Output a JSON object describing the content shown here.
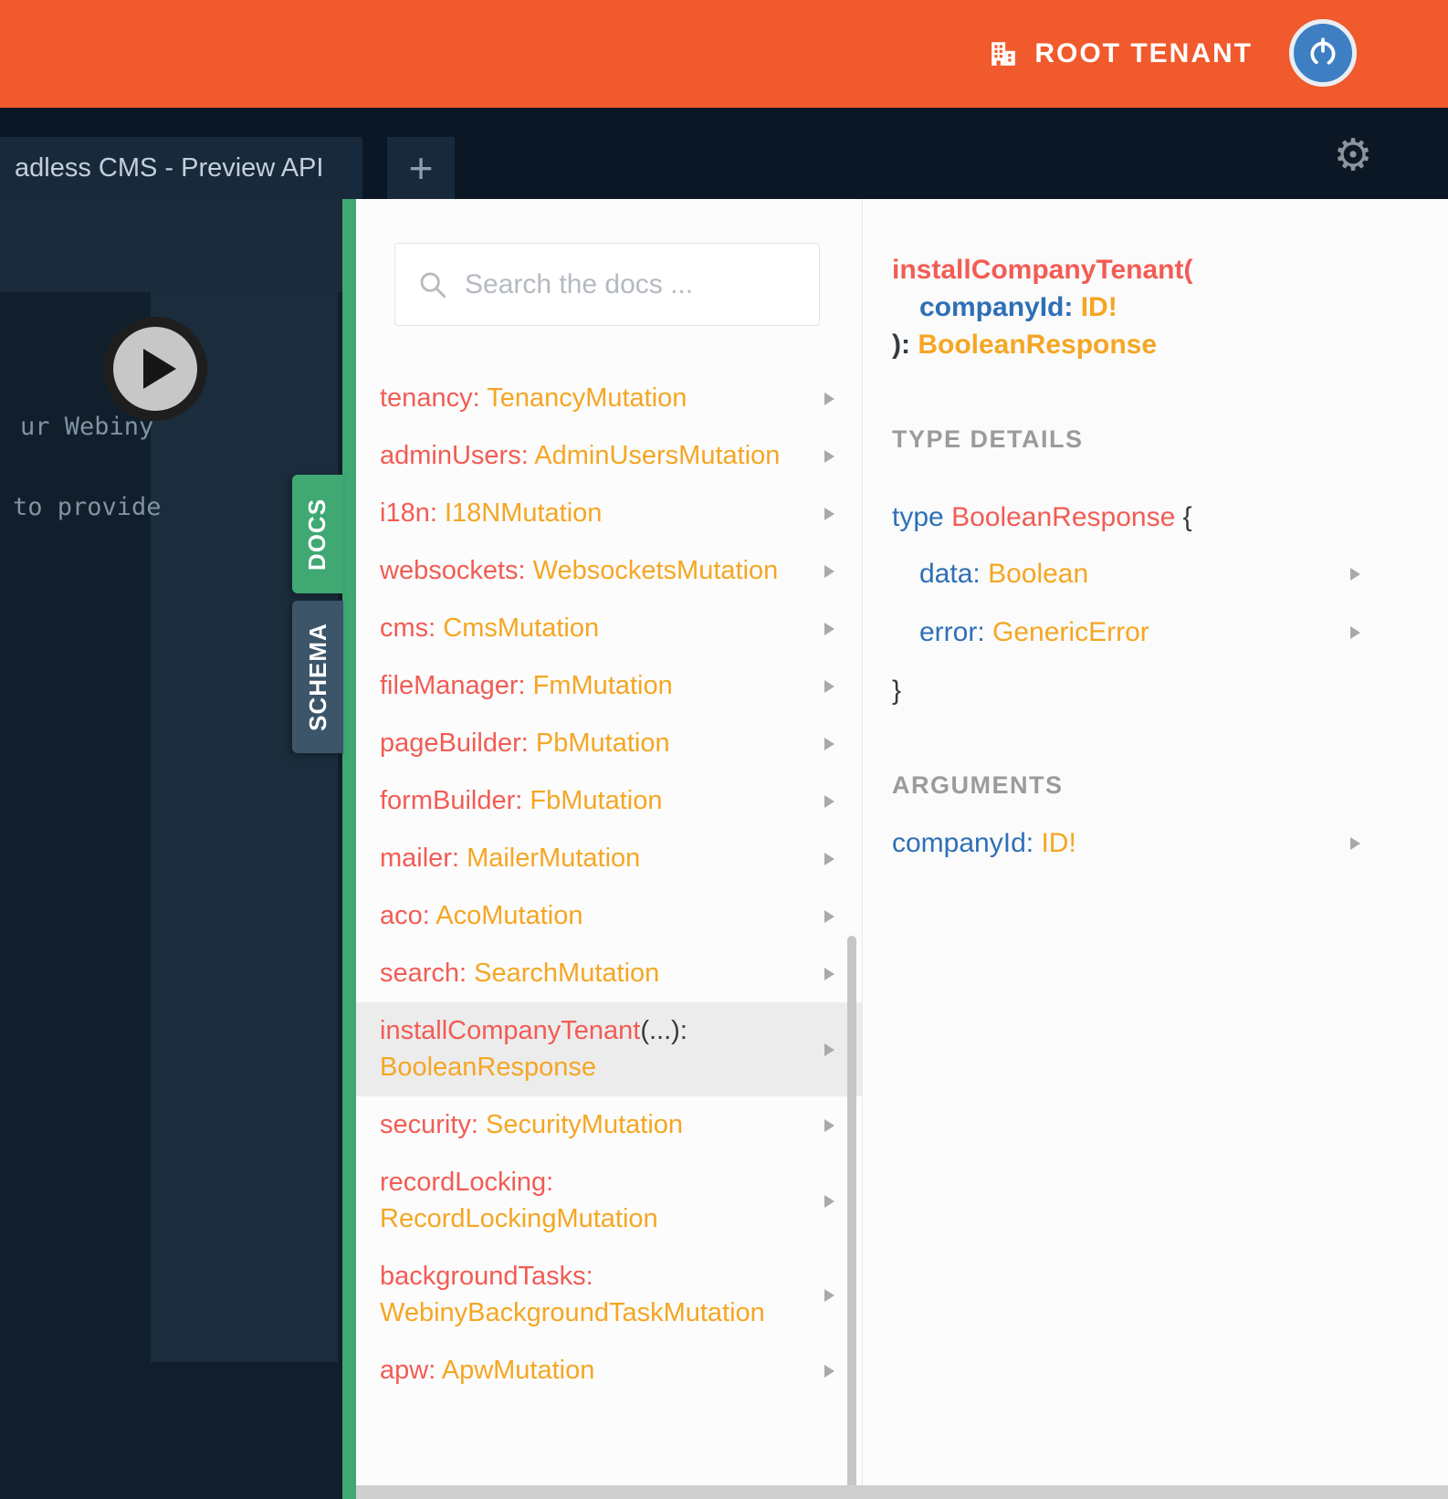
{
  "colors": {
    "accent_orange": "#f05a2c",
    "docs_green": "#3fa873",
    "schema_slate": "#3d5569",
    "field_red": "#f25c54",
    "type_orange": "#f5a623",
    "keyword_blue": "#2e6fb7"
  },
  "icons": {
    "gear_glyph": "⚙",
    "add_tab_glyph": "+"
  },
  "header": {
    "tenant_label": "ROOT TENANT"
  },
  "tabbar": {
    "tab_title": "adless CMS - Preview API"
  },
  "editor": {
    "line1": "ur Webiny",
    "line2": "to provide"
  },
  "side_tabs": {
    "docs": "DOCS",
    "schema": "SCHEMA"
  },
  "docs": {
    "search_placeholder": "Search the docs ...",
    "items": [
      {
        "name": "tenancy:",
        "type": "TenancyMutation"
      },
      {
        "name": "adminUsers:",
        "type": "AdminUsersMutation"
      },
      {
        "name": "i18n:",
        "type": "I18NMutation"
      },
      {
        "name": "websockets:",
        "type": "WebsocketsMutation"
      },
      {
        "name": "cms:",
        "type": "CmsMutation"
      },
      {
        "name": "fileManager:",
        "type": "FmMutation"
      },
      {
        "name": "pageBuilder:",
        "type": "PbMutation"
      },
      {
        "name": "formBuilder:",
        "type": "FbMutation"
      },
      {
        "name": "mailer:",
        "type": "MailerMutation"
      },
      {
        "name": "aco:",
        "type": "AcoMutation"
      },
      {
        "name": "search:",
        "type": "SearchMutation"
      },
      {
        "name": "installCompanyTenant",
        "paren": "(...):",
        "type": "BooleanResponse"
      },
      {
        "name": "security:",
        "type": "SecurityMutation"
      },
      {
        "name": "recordLocking:",
        "type": "RecordLockingMutation"
      },
      {
        "name": "backgroundTasks:",
        "type": "WebinyBackgroundTaskMutation"
      },
      {
        "name": "apw:",
        "type": "ApwMutation"
      }
    ]
  },
  "detail": {
    "signature": {
      "name": "installCompanyTenant(",
      "arg_name": "companyId:",
      "arg_type": "ID!",
      "close": "):",
      "return_type": "BooleanResponse"
    },
    "type_details_heading": "TYPE DETAILS",
    "type_keyword": "type",
    "type_name": "BooleanResponse",
    "open_brace": "{",
    "fields": [
      {
        "name": "data:",
        "type": "Boolean"
      },
      {
        "name": "error:",
        "type": "GenericError"
      }
    ],
    "close_brace": "}",
    "arguments_heading": "ARGUMENTS",
    "argument": {
      "name": "companyId:",
      "type": "ID!"
    }
  }
}
